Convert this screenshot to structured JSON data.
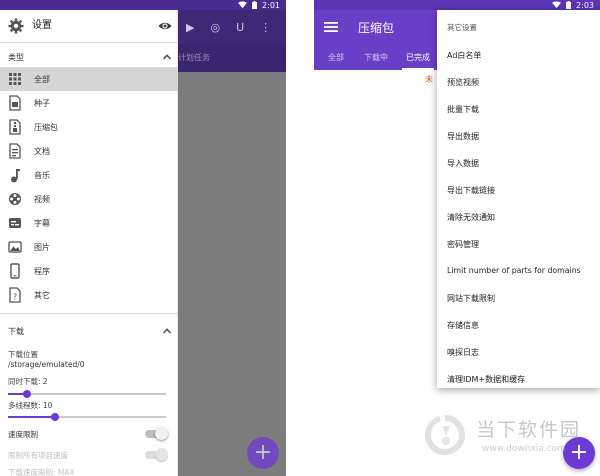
{
  "left_screen": {
    "status_time": "2:01",
    "background_tab_fragment": "计划任务",
    "drawer": {
      "title": "设置",
      "type_section_label": "类型",
      "categories": [
        {
          "label": "全部",
          "icon": "grid-icon",
          "active": true
        },
        {
          "label": "种子",
          "icon": "torrent-file-icon",
          "active": false
        },
        {
          "label": "压缩包",
          "icon": "archive-file-icon",
          "active": false
        },
        {
          "label": "文档",
          "icon": "document-icon",
          "active": false
        },
        {
          "label": "音乐",
          "icon": "music-note-icon",
          "active": false
        },
        {
          "label": "视频",
          "icon": "film-reel-icon",
          "active": false
        },
        {
          "label": "字幕",
          "icon": "subtitles-icon",
          "active": false
        },
        {
          "label": "图片",
          "icon": "image-icon",
          "active": false
        },
        {
          "label": "程序",
          "icon": "phone-app-icon",
          "active": false
        },
        {
          "label": "其它",
          "icon": "unknown-file-icon",
          "active": false
        }
      ],
      "download_section_label": "下载",
      "download_location_label": "下载位置",
      "download_location_path": "/storage/emulated/0",
      "simultaneous_label": "同时下载: 2",
      "simultaneous_fraction": 0.12,
      "threads_label": "多线程数: 10",
      "threads_fraction": 0.3,
      "speed_limit_label": "速度限制",
      "limit_all_label": "限制所有项目速度",
      "max_speed_label": "下载速度限制: MAX"
    }
  },
  "right_screen": {
    "status_time": "2:03",
    "toolbar_title": "压缩包",
    "tabs": [
      "全部",
      "下载中",
      "已完成"
    ],
    "active_tab": "已完成",
    "unfinished_fragment": "未",
    "popup_header": "其它设置",
    "popup_items": [
      "Ad白名单",
      "预览视频",
      "批量下载",
      "导出数据",
      "导入数据",
      "导出下载链接",
      "清除无效通知",
      "密码管理",
      "Limit number of parts for domains",
      "网站下载限制",
      "存储信息",
      "嗅探日志",
      "清理IDM+数据和缓存"
    ]
  },
  "watermark": {
    "title": "当下软件园",
    "url": "www.downxia.com"
  },
  "colors": {
    "accent": "#6c3ad4",
    "toolbar": "#6a3fc8",
    "unfinished": "#e8541a"
  }
}
